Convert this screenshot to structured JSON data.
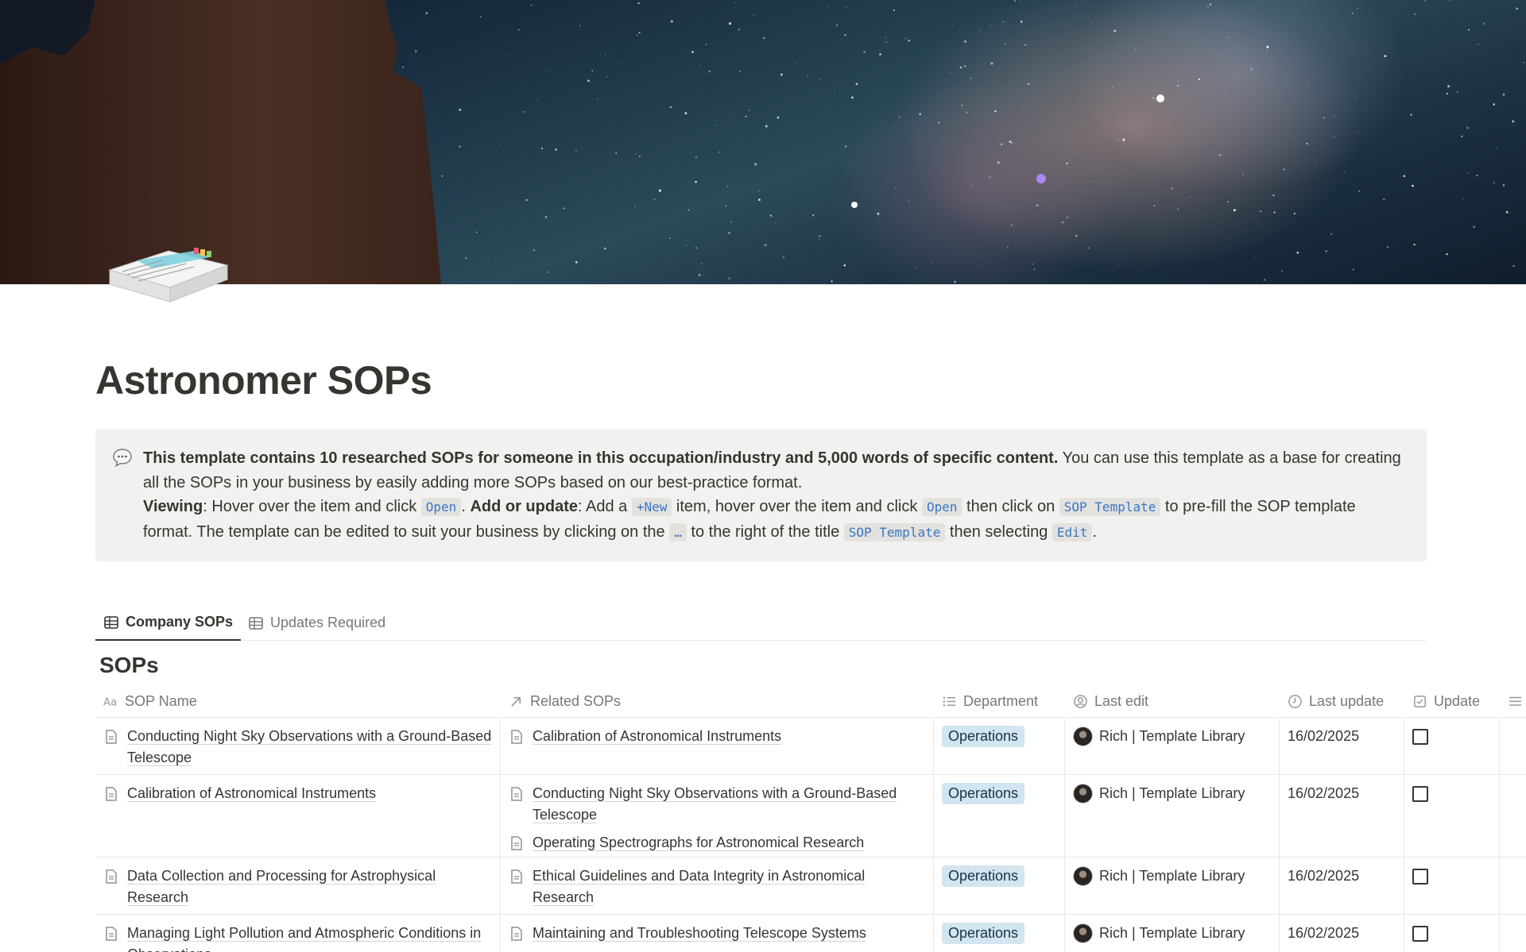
{
  "page": {
    "title": "Astronomer SOPs",
    "cover_description_icon": "document-stack-icon"
  },
  "callout": {
    "icon": "speech-bubble-icon",
    "bold_intro": "This template contains 10 researched SOPs for someone in this occupation/industry and 5,000 words of specific content.",
    "intro_rest": " You can use this template as a base for creating all the SOPs in your business by easily adding more SOPs based on our best-practice format.",
    "viewing_label": "Viewing",
    "viewing_text_1": ": Hover over the item and click ",
    "code_open": "Open",
    "viewing_text_2": ". ",
    "add_label": "Add or update",
    "add_text_1": ": Add a ",
    "code_new": "+New",
    "add_text_2": " item, hover over the item and click ",
    "add_text_3": " then click on ",
    "code_sop_template": "SOP Template",
    "add_text_4": " to pre-fill the SOP template format. The template can be edited to suit your business by clicking on the ",
    "code_dots": "…",
    "add_text_5": " to the right of the title ",
    "add_text_6": " then selecting ",
    "code_edit": "Edit",
    "add_text_7": "."
  },
  "tabs": [
    {
      "label": "Company SOPs",
      "active": true,
      "icon": "table-icon"
    },
    {
      "label": "Updates Required",
      "active": false,
      "icon": "table-icon"
    }
  ],
  "database": {
    "title": "SOPs",
    "columns": [
      {
        "label": "SOP Name",
        "icon": "text-aa-icon"
      },
      {
        "label": "Related SOPs",
        "icon": "relation-arrow-icon"
      },
      {
        "label": "Department",
        "icon": "list-icon"
      },
      {
        "label": "Last edit",
        "icon": "person-icon"
      },
      {
        "label": "Last update",
        "icon": "clock-icon"
      },
      {
        "label": "Update",
        "icon": "checkbox-icon"
      }
    ],
    "rows": [
      {
        "name": "Conducting Night Sky Observations with a Ground-Based Telescope",
        "related": [
          "Calibration of Astronomical Instruments"
        ],
        "department": "Operations",
        "last_edit": "Rich | Template Library",
        "last_update": "16/02/2025",
        "update": false
      },
      {
        "name": "Calibration of Astronomical Instruments",
        "related": [
          "Conducting Night Sky Observations with a Ground-Based Telescope",
          "Operating Spectrographs for Astronomical Research"
        ],
        "department": "Operations",
        "last_edit": "Rich | Template Library",
        "last_update": "16/02/2025",
        "update": false
      },
      {
        "name": "Data Collection and Processing for Astrophysical Research",
        "related": [
          "Ethical Guidelines and Data Integrity in Astronomical Research"
        ],
        "department": "Operations",
        "last_edit": "Rich | Template Library",
        "last_update": "16/02/2025",
        "update": false
      },
      {
        "name": "Managing Light Pollution and Atmospheric Conditions in Observations",
        "related": [
          "Maintaining and Troubleshooting Telescope Systems"
        ],
        "department": "Operations",
        "last_edit": "Rich | Template Library",
        "last_update": "16/02/2025",
        "update": false
      }
    ]
  }
}
